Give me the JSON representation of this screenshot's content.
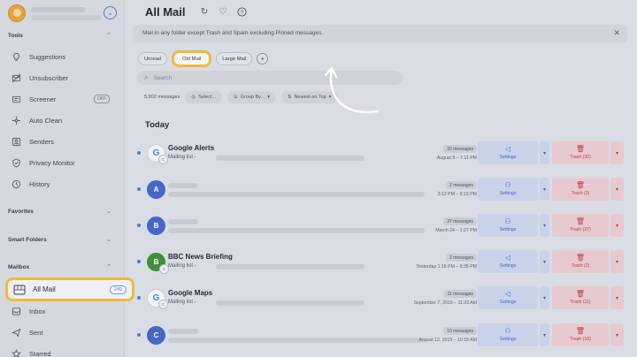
{
  "sidebar": {
    "tools_header": "Tools",
    "tools": [
      {
        "label": "Suggestions",
        "icon": "lightbulb-icon"
      },
      {
        "label": "Unsubscriber",
        "icon": "unsubscribe-icon"
      },
      {
        "label": "Screener",
        "icon": "screener-icon",
        "badge": "OFF"
      },
      {
        "label": "Auto Clean",
        "icon": "auto-clean-icon"
      },
      {
        "label": "Senders",
        "icon": "senders-icon"
      },
      {
        "label": "Privacy Monitor",
        "icon": "shield-icon"
      },
      {
        "label": "History",
        "icon": "history-icon"
      }
    ],
    "favorites_header": "Favorites",
    "smart_folders_header": "Smart Folders",
    "mailbox_header": "Mailbox",
    "mailbox": [
      {
        "label": "All Mail",
        "count": "249",
        "icon": "all-mail-icon",
        "selected": true
      },
      {
        "label": "Inbox",
        "icon": "inbox-icon"
      },
      {
        "label": "Sent",
        "icon": "sent-icon"
      },
      {
        "label": "Starred",
        "icon": "star-icon"
      }
    ]
  },
  "main": {
    "title": "All Mail",
    "banner": "Mail in any folder except Trash and Spam excluding Pinned messages.",
    "chips": [
      "Unread",
      "Old Mail",
      "Large Mail"
    ],
    "active_chip": "Old Mail",
    "search_placeholder": "Search",
    "toolbar": {
      "count": "5,902 messages",
      "select": "Select...",
      "group_by": "Group By...",
      "sort": "Newest on Top"
    },
    "section": "Today",
    "rows": [
      {
        "sender": "Google Alerts",
        "sub": "Mailing list -",
        "count": "32 messages",
        "date": "August 9 – 7:11 PM",
        "settings": "Settings",
        "trash": "Trash (30)",
        "avatar": "G",
        "avatar_type": "google",
        "settings_icon": "megaphone-icon"
      },
      {
        "sender": "",
        "sub": "",
        "count": "2 messages",
        "date": "3:12 PM – 9:16 PM",
        "settings": "Settings",
        "trash": "Trash (2)",
        "avatar": "A",
        "avatar_type": "letter",
        "settings_icon": "person-icon"
      },
      {
        "sender": "",
        "sub": "",
        "count": "37 messages",
        "date": "March 24 – 1:27 PM",
        "settings": "Settings",
        "trash": "Trash (37)",
        "avatar": "B",
        "avatar_type": "letter",
        "settings_icon": "person-icon"
      },
      {
        "sender": "BBC News Briefing",
        "sub": "Mailing list -",
        "count": "2 messages",
        "date": "Yesterday 1:16 PM – 9:35 PM",
        "settings": "Settings",
        "trash": "Trash (2)",
        "avatar": "B",
        "avatar_type": "bbc",
        "settings_icon": "megaphone-icon"
      },
      {
        "sender": "Google Maps",
        "sub": "Mailing list -",
        "count": "11 messages",
        "date": "September 7, 2019 – 11:23 AM",
        "settings": "Settings",
        "trash": "Trash (11)",
        "avatar": "G",
        "avatar_type": "google",
        "settings_icon": "megaphone-icon"
      },
      {
        "sender": "",
        "sub": "",
        "count": "10 messages",
        "date": "August 12, 2019 – 10:15 AM",
        "settings": "Settings",
        "trash": "Trash (10)",
        "avatar": "C",
        "avatar_type": "letter",
        "settings_icon": "person-icon"
      }
    ]
  },
  "colors": {
    "accent_highlight": "#f1b93d",
    "settings_blue": "#3f64c4",
    "trash_red": "#c23a45"
  }
}
